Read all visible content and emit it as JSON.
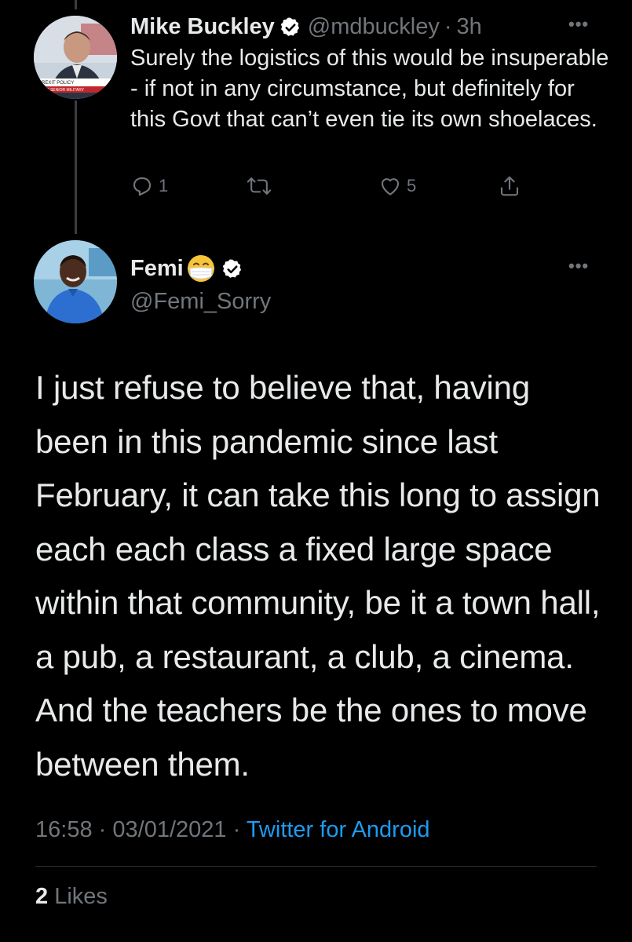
{
  "reply_tweet": {
    "author_name": "Mike Buckley",
    "handle": "@mdbuckley",
    "separator": "·",
    "time": "3h",
    "text": "Surely the logistics of this would be insuperable - if not in any circumstance, but definitely for this Govt that can’t even tie its own shoelaces.",
    "reply_count": "1",
    "retweet_count": "",
    "like_count": "5",
    "avatar_caption_line1": "BREXIT POLICY",
    "avatar_caption_line2": "10 SENIOR MILITARY"
  },
  "main_tweet": {
    "author_name": "Femi",
    "handle": "@Femi_Sorry",
    "text": "I just refuse to believe that, having been in this pandemic since last February, it can take this long to assign each each class a fixed large space within that community, be it a town hall, a pub, a restaurant, a club, a cinema. And the teachers be the ones to move between them.",
    "time": "16:58",
    "separator1": "·",
    "date": "03/01/2021",
    "separator2": "·",
    "source": "Twitter for Android",
    "likes_count": "2",
    "likes_label": "Likes"
  },
  "icons": {
    "verified": "verified-badge-icon",
    "more": "more-dots-icon",
    "reply": "reply-icon",
    "retweet": "retweet-icon",
    "like": "heart-icon",
    "share": "share-icon",
    "emoji": "face-with-medical-mask-emoji"
  },
  "colors": {
    "background": "#000000",
    "primary_text": "#e7e9ea",
    "secondary_text": "#71767b",
    "link": "#1d9bf0",
    "divider": "#2f3336"
  }
}
